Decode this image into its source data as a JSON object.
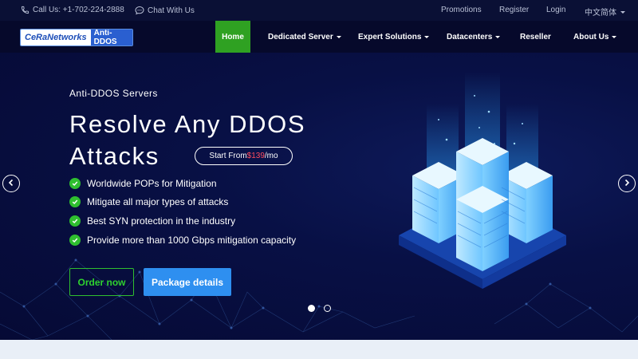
{
  "topbar": {
    "phone_label": "Call Us: +1-702-224-2888",
    "chat_label": "Chat With Us",
    "links": [
      "Promotions",
      "Register",
      "Login",
      "中文简体"
    ]
  },
  "logo": {
    "part1": "CeRaNetworks",
    "part2": "Anti-DDOS"
  },
  "nav": {
    "items": [
      {
        "label": "Home",
        "active": true,
        "dropdown": false
      },
      {
        "label": "Dedicated Server",
        "dropdown": true
      },
      {
        "label": "Expert Solutions",
        "dropdown": true
      },
      {
        "label": "Datacenters",
        "dropdown": true
      },
      {
        "label": "Reseller",
        "dropdown": false
      },
      {
        "label": "About Us",
        "dropdown": true
      }
    ]
  },
  "hero": {
    "eyebrow": "Anti-DDOS Servers",
    "headline": "Resolve Any DDOS Attacks",
    "price": {
      "prefix": "Start From ",
      "amount": "$139",
      "suffix": "/mo"
    },
    "features": [
      "Worldwide POPs for Mitigation",
      "Mitigate all major types of attacks",
      "Best SYN protection in the industry",
      "Provide more than 1000 Gbps mitigation capacity"
    ],
    "order_button": "Order now",
    "package_button": "Package details",
    "slides": 2,
    "active_slide": 1
  },
  "colors": {
    "accent_green": "#2fa122",
    "button_blue": "#2e8ff0",
    "price_red": "#ff4d5e",
    "hero_bg": "#081045"
  },
  "icons": [
    "phone-icon",
    "chat-icon",
    "check-icon",
    "chevron-left-icon",
    "chevron-right-icon"
  ]
}
